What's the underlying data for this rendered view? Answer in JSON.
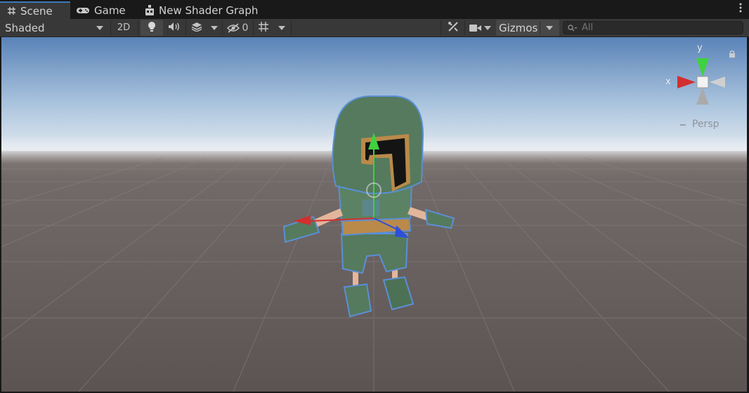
{
  "tabs": {
    "scene": "Scene",
    "game": "Game",
    "shader_graph": "New Shader Graph"
  },
  "toolbar": {
    "draw_mode": "Shaded",
    "toggle_2d": "2D",
    "hidden_count": "0",
    "gizmos": "Gizmos",
    "search_placeholder": "All"
  },
  "orientation_gizmo": {
    "x_label": "x",
    "y_label": "y",
    "projection": "Persp"
  },
  "colors": {
    "x_axis": "#d32f2f",
    "y_axis": "#3fd13f",
    "z_axis": "#2d4fd8",
    "character_body": "#557a5e",
    "character_trim": "#b98a4a",
    "selection_outline": "#5a8fd6"
  }
}
